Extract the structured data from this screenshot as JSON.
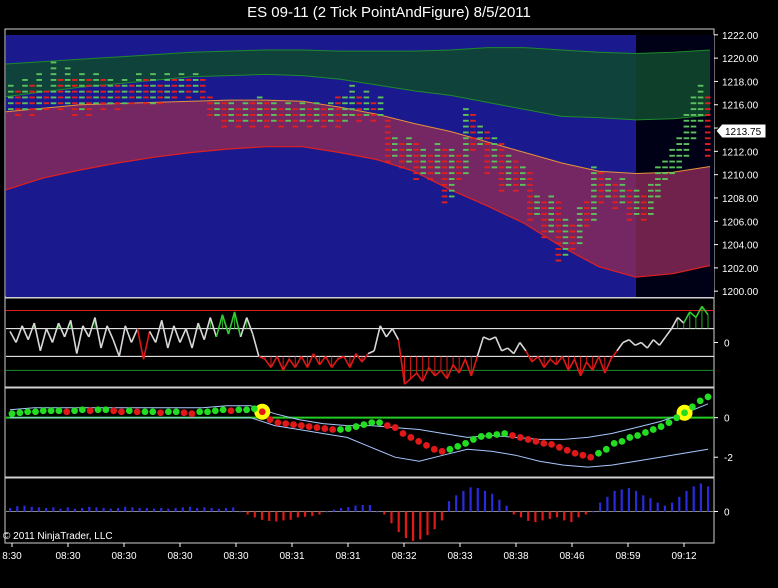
{
  "window": {
    "title": "ES 09-11 (2 Tick PointAndFigure)  8/5/2011"
  },
  "colors": {
    "background": "#000000",
    "up_box": "#5cc15c",
    "down_box": "#e01e1e",
    "band_blue": "#1c1c9c",
    "band_red": "#8c2a5a",
    "upper_band": "#17701c",
    "ma_line": "#e8913a",
    "dot_up": "#22dd22",
    "dot_down": "#e01818",
    "highlight": "#ffff00",
    "hist_pos": "#2a2ae0",
    "hist_neg": "#e01818"
  },
  "chart_data": [
    {
      "type": "point-and-figure",
      "panel": "price",
      "ylim": [
        1199.5,
        1222.5
      ],
      "y_ticks": [
        "1222.00",
        "1220.00",
        "1218.00",
        "1216.00",
        "1214.00",
        "1212.00",
        "1210.00",
        "1208.00",
        "1206.00",
        "1204.00",
        "1202.00",
        "1200.00"
      ],
      "last_price_label": "1213.75",
      "last_price": 1213.75,
      "columns": [
        {
          "low": 1215.5,
          "high": 1217.5,
          "dir": "up"
        },
        {
          "low": 1215.0,
          "high": 1217.0,
          "dir": "down"
        },
        {
          "low": 1215.5,
          "high": 1218.0,
          "dir": "up"
        },
        {
          "low": 1215.0,
          "high": 1217.5,
          "dir": "down"
        },
        {
          "low": 1215.5,
          "high": 1218.5,
          "dir": "up"
        },
        {
          "low": 1215.5,
          "high": 1217.0,
          "dir": "down"
        },
        {
          "low": 1216.0,
          "high": 1219.5,
          "dir": "up"
        },
        {
          "low": 1215.5,
          "high": 1218.0,
          "dir": "down"
        },
        {
          "low": 1216.0,
          "high": 1219.0,
          "dir": "up"
        },
        {
          "low": 1215.0,
          "high": 1218.0,
          "dir": "down"
        },
        {
          "low": 1215.5,
          "high": 1218.5,
          "dir": "up"
        },
        {
          "low": 1215.0,
          "high": 1218.0,
          "dir": "down"
        },
        {
          "low": 1216.0,
          "high": 1218.5,
          "dir": "up"
        },
        {
          "low": 1215.5,
          "high": 1218.0,
          "dir": "down"
        },
        {
          "low": 1216.0,
          "high": 1218.0,
          "dir": "up"
        },
        {
          "low": 1215.5,
          "high": 1217.5,
          "dir": "down"
        },
        {
          "low": 1216.0,
          "high": 1218.0,
          "dir": "up"
        },
        {
          "low": 1216.0,
          "high": 1217.5,
          "dir": "down"
        },
        {
          "low": 1216.5,
          "high": 1218.5,
          "dir": "up"
        },
        {
          "low": 1216.0,
          "high": 1218.0,
          "dir": "down"
        },
        {
          "low": 1216.0,
          "high": 1218.5,
          "dir": "up"
        },
        {
          "low": 1216.0,
          "high": 1217.5,
          "dir": "down"
        },
        {
          "low": 1216.5,
          "high": 1218.5,
          "dir": "up"
        },
        {
          "low": 1216.5,
          "high": 1218.0,
          "dir": "down"
        },
        {
          "low": 1217.0,
          "high": 1218.5,
          "dir": "up"
        },
        {
          "low": 1216.5,
          "high": 1218.0,
          "dir": "down"
        },
        {
          "low": 1217.0,
          "high": 1218.5,
          "dir": "up"
        },
        {
          "low": 1216.5,
          "high": 1218.0,
          "dir": "down"
        },
        {
          "low": 1215.0,
          "high": 1216.5,
          "dir": "down"
        },
        {
          "low": 1215.0,
          "high": 1216.0,
          "dir": "up"
        },
        {
          "low": 1214.0,
          "high": 1216.0,
          "dir": "down"
        },
        {
          "low": 1214.5,
          "high": 1216.0,
          "dir": "up"
        },
        {
          "low": 1214.0,
          "high": 1215.5,
          "dir": "down"
        },
        {
          "low": 1214.5,
          "high": 1216.0,
          "dir": "up"
        },
        {
          "low": 1214.0,
          "high": 1216.0,
          "dir": "down"
        },
        {
          "low": 1214.5,
          "high": 1216.5,
          "dir": "up"
        },
        {
          "low": 1214.0,
          "high": 1216.0,
          "dir": "down"
        },
        {
          "low": 1214.5,
          "high": 1216.0,
          "dir": "up"
        },
        {
          "low": 1214.0,
          "high": 1215.5,
          "dir": "down"
        },
        {
          "low": 1214.5,
          "high": 1216.0,
          "dir": "up"
        },
        {
          "low": 1214.0,
          "high": 1215.5,
          "dir": "down"
        },
        {
          "low": 1214.5,
          "high": 1216.0,
          "dir": "up"
        },
        {
          "low": 1214.0,
          "high": 1215.5,
          "dir": "down"
        },
        {
          "low": 1214.5,
          "high": 1216.0,
          "dir": "up"
        },
        {
          "low": 1214.0,
          "high": 1215.5,
          "dir": "down"
        },
        {
          "low": 1214.5,
          "high": 1216.0,
          "dir": "up"
        },
        {
          "low": 1214.0,
          "high": 1216.5,
          "dir": "down"
        },
        {
          "low": 1214.5,
          "high": 1216.5,
          "dir": "up"
        },
        {
          "low": 1215.0,
          "high": 1217.5,
          "dir": "up"
        },
        {
          "low": 1214.5,
          "high": 1216.5,
          "dir": "down"
        },
        {
          "low": 1215.0,
          "high": 1217.0,
          "dir": "up"
        },
        {
          "low": 1214.5,
          "high": 1216.0,
          "dir": "down"
        },
        {
          "low": 1215.0,
          "high": 1216.5,
          "dir": "up"
        },
        {
          "low": 1211.0,
          "high": 1214.5,
          "dir": "down"
        },
        {
          "low": 1211.5,
          "high": 1213.0,
          "dir": "up"
        },
        {
          "low": 1210.5,
          "high": 1212.5,
          "dir": "down"
        },
        {
          "low": 1211.0,
          "high": 1213.0,
          "dir": "up"
        },
        {
          "low": 1209.5,
          "high": 1212.5,
          "dir": "down"
        },
        {
          "low": 1210.0,
          "high": 1212.0,
          "dir": "up"
        },
        {
          "low": 1209.5,
          "high": 1211.5,
          "dir": "down"
        },
        {
          "low": 1210.0,
          "high": 1212.5,
          "dir": "up"
        },
        {
          "low": 1207.5,
          "high": 1212.0,
          "dir": "down"
        },
        {
          "low": 1208.0,
          "high": 1212.0,
          "dir": "up"
        },
        {
          "low": 1209.5,
          "high": 1211.5,
          "dir": "down"
        },
        {
          "low": 1210.0,
          "high": 1215.5,
          "dir": "up"
        },
        {
          "low": 1212.0,
          "high": 1215.0,
          "dir": "down"
        },
        {
          "low": 1212.5,
          "high": 1214.0,
          "dir": "up"
        },
        {
          "low": 1210.0,
          "high": 1213.5,
          "dir": "down"
        },
        {
          "low": 1210.5,
          "high": 1213.0,
          "dir": "up"
        },
        {
          "low": 1208.5,
          "high": 1212.5,
          "dir": "down"
        },
        {
          "low": 1209.0,
          "high": 1211.5,
          "dir": "up"
        },
        {
          "low": 1208.5,
          "high": 1211.0,
          "dir": "down"
        },
        {
          "low": 1209.0,
          "high": 1210.5,
          "dir": "up"
        },
        {
          "low": 1206.0,
          "high": 1210.0,
          "dir": "down"
        },
        {
          "low": 1206.5,
          "high": 1208.0,
          "dir": "up"
        },
        {
          "low": 1204.5,
          "high": 1207.5,
          "dir": "down"
        },
        {
          "low": 1205.0,
          "high": 1208.0,
          "dir": "up"
        },
        {
          "low": 1202.5,
          "high": 1207.5,
          "dir": "down"
        },
        {
          "low": 1203.0,
          "high": 1206.0,
          "dir": "up"
        },
        {
          "low": 1203.5,
          "high": 1205.5,
          "dir": "down"
        },
        {
          "low": 1204.0,
          "high": 1207.0,
          "dir": "up"
        },
        {
          "low": 1205.5,
          "high": 1207.5,
          "dir": "down"
        },
        {
          "low": 1206.0,
          "high": 1210.5,
          "dir": "up"
        },
        {
          "low": 1207.5,
          "high": 1210.0,
          "dir": "down"
        },
        {
          "low": 1208.0,
          "high": 1209.5,
          "dir": "up"
        },
        {
          "low": 1207.0,
          "high": 1209.0,
          "dir": "down"
        },
        {
          "low": 1207.5,
          "high": 1209.5,
          "dir": "up"
        },
        {
          "low": 1206.0,
          "high": 1208.5,
          "dir": "down"
        },
        {
          "low": 1206.5,
          "high": 1208.5,
          "dir": "up"
        },
        {
          "low": 1206.0,
          "high": 1208.0,
          "dir": "down"
        },
        {
          "low": 1206.5,
          "high": 1209.0,
          "dir": "up"
        },
        {
          "low": 1208.0,
          "high": 1210.5,
          "dir": "up"
        },
        {
          "low": 1209.5,
          "high": 1211.0,
          "dir": "up"
        },
        {
          "low": 1210.0,
          "high": 1212.0,
          "dir": "up"
        },
        {
          "low": 1210.5,
          "high": 1213.0,
          "dir": "up"
        },
        {
          "low": 1211.5,
          "high": 1215.0,
          "dir": "up"
        },
        {
          "low": 1213.0,
          "high": 1216.5,
          "dir": "up"
        },
        {
          "low": 1214.5,
          "high": 1217.5,
          "dir": "up"
        },
        {
          "low": 1211.5,
          "high": 1216.5,
          "dir": "down"
        }
      ],
      "upper_band": [
        1219.5,
        1219.7,
        1219.9,
        1220.1,
        1220.3,
        1220.5,
        1220.6,
        1220.7,
        1220.7,
        1220.6,
        1220.6,
        1220.6,
        1220.7,
        1220.9,
        1220.9,
        1220.7,
        1220.5,
        1220.4,
        1220.5,
        1220.7
      ],
      "mid_line": [
        1216.7,
        1217.1,
        1217.5,
        1217.8,
        1218.1,
        1218.4,
        1218.5,
        1218.6,
        1218.5,
        1218.2,
        1217.7,
        1217.2,
        1216.8,
        1216.2,
        1215.6,
        1215.0,
        1214.9,
        1214.7,
        1214.8,
        1215.1
      ],
      "ma_line": [
        1215.4,
        1215.7,
        1216.0,
        1216.1,
        1216.2,
        1216.3,
        1216.4,
        1216.4,
        1216.3,
        1215.8,
        1215.2,
        1214.4,
        1213.7,
        1212.8,
        1211.9,
        1211.0,
        1210.3,
        1210.1,
        1210.2,
        1210.7
      ],
      "lower_band": [
        1208.7,
        1209.7,
        1210.4,
        1211.0,
        1211.5,
        1211.9,
        1212.2,
        1212.4,
        1212.4,
        1211.9,
        1211.3,
        1210.3,
        1208.7,
        1207.3,
        1205.8,
        1203.8,
        1202.1,
        1201.2,
        1201.5,
        1202.2
      ]
    },
    {
      "type": "line",
      "panel": "oscillator-1",
      "ylim": [
        -1.6,
        1.6
      ],
      "y_ticks": [
        "0"
      ],
      "levels": [
        1.15,
        0.5,
        -0.5,
        -1.0
      ],
      "values": [
        0.4,
        0.0,
        0.6,
        0.1,
        0.7,
        -0.3,
        0.5,
        0.0,
        0.7,
        0.2,
        0.8,
        -0.4,
        0.6,
        0.2,
        0.9,
        -0.2,
        0.6,
        0.1,
        -0.5,
        0.6,
        0.0,
        0.5,
        -0.6,
        0.4,
        0.0,
        0.8,
        -0.2,
        0.6,
        0.0,
        0.5,
        -0.2,
        0.7,
        0.1,
        0.9,
        0.2,
        1.0,
        0.3,
        1.1,
        0.2,
        0.9,
        0.3,
        -0.5,
        -0.6,
        -0.9,
        -0.5,
        -1.0,
        -0.6,
        -0.9,
        -0.5,
        -0.9,
        -0.4,
        -0.8,
        -0.5,
        -0.9,
        -0.6,
        -0.5,
        -0.9,
        -0.4,
        -0.7,
        -0.4,
        -0.3,
        0.6,
        0.2,
        0.5,
        0.1,
        -1.5,
        -1.3,
        -1.1,
        -1.4,
        -0.9,
        -1.2,
        -1.0,
        -1.3,
        -0.8,
        -1.1,
        -0.6,
        -1.2,
        -0.5,
        0.2,
        0.1,
        0.2,
        -0.3,
        -0.2,
        -0.4,
        0.0,
        -0.3,
        -0.7,
        -0.5,
        -0.9,
        -0.6,
        -0.8,
        -0.5,
        -1.0,
        -0.6,
        -1.2,
        -0.7,
        -1.0,
        -0.5,
        -1.1,
        -0.6,
        -0.3,
        0.0,
        0.1,
        -0.1,
        0.0,
        -0.2,
        0.1,
        -0.1,
        0.2,
        0.5,
        0.9,
        0.7,
        1.1,
        0.9,
        1.3,
        1.0
      ]
    },
    {
      "type": "scatter",
      "panel": "oscillator-2",
      "ylim": [
        -3.0,
        1.5
      ],
      "y_ticks": [
        "0",
        "-2"
      ],
      "values": [
        0.2,
        0.25,
        0.3,
        0.3,
        0.35,
        0.35,
        0.35,
        0.3,
        0.35,
        0.4,
        0.35,
        0.4,
        0.4,
        0.35,
        0.3,
        0.35,
        0.3,
        0.3,
        0.3,
        0.25,
        0.3,
        0.3,
        0.25,
        0.2,
        0.3,
        0.3,
        0.35,
        0.4,
        0.35,
        0.4,
        0.4,
        0.45,
        0.3,
        -0.1,
        -0.25,
        -0.3,
        -0.35,
        -0.4,
        -0.45,
        -0.5,
        -0.55,
        -0.6,
        -0.6,
        -0.55,
        -0.45,
        -0.35,
        -0.25,
        -0.25,
        -0.4,
        -0.5,
        -0.8,
        -1.0,
        -1.2,
        -1.4,
        -1.6,
        -1.7,
        -1.6,
        -1.45,
        -1.3,
        -1.1,
        -0.95,
        -0.9,
        -0.85,
        -0.8,
        -0.9,
        -1.0,
        -1.1,
        -1.2,
        -1.3,
        -1.35,
        -1.5,
        -1.65,
        -1.8,
        -1.9,
        -2.0,
        -1.8,
        -1.6,
        -1.3,
        -1.2,
        -1.0,
        -0.9,
        -0.75,
        -0.6,
        -0.45,
        -0.25,
        0.0,
        0.25,
        0.55,
        0.85,
        1.05
      ],
      "upper_band": [
        0.4,
        0.5,
        0.5,
        0.5,
        0.5,
        0.5,
        0.5,
        0.5,
        0.5,
        0.6,
        0.6,
        0.2,
        -0.1,
        -0.3,
        -0.4,
        -0.4,
        -0.5,
        -0.6,
        -0.8,
        -1.0,
        -0.9,
        -1.0,
        -1.1,
        -1.1,
        -1.0,
        -0.8,
        -0.5,
        -0.2,
        0.2,
        0.7
      ],
      "lower_band": [
        0.0,
        0.0,
        0.0,
        0.0,
        0.0,
        0.0,
        0.0,
        0.0,
        0.0,
        0.0,
        0.0,
        -0.4,
        -0.6,
        -0.8,
        -1.0,
        -1.5,
        -2.0,
        -2.2,
        -1.9,
        -1.6,
        -1.7,
        -1.9,
        -2.2,
        -2.4,
        -2.5,
        -2.4,
        -2.2,
        -2.0,
        -1.8,
        -1.6
      ],
      "highlights": [
        32,
        86
      ]
    },
    {
      "type": "bar",
      "panel": "histogram",
      "ylim": [
        -1.0,
        1.0
      ],
      "y_ticks": [
        "0"
      ],
      "values": [
        0.12,
        0.18,
        0.2,
        0.16,
        0.14,
        0.12,
        0.14,
        0.1,
        0.14,
        0.1,
        0.12,
        0.16,
        0.14,
        0.12,
        0.1,
        0.12,
        0.16,
        0.14,
        0.12,
        0.12,
        0.1,
        0.12,
        0.1,
        0.12,
        0.14,
        0.16,
        0.12,
        0.14,
        0.12,
        0.1,
        0.12,
        0.14,
        0.0,
        -0.1,
        -0.2,
        -0.28,
        -0.32,
        -0.34,
        -0.3,
        -0.28,
        -0.2,
        -0.18,
        -0.15,
        -0.1,
        0.0,
        0.06,
        0.12,
        0.15,
        0.2,
        0.22,
        0.22,
        0.0,
        -0.1,
        -0.4,
        -0.7,
        -0.9,
        -1.0,
        -0.95,
        -0.8,
        -0.6,
        -0.3,
        0.35,
        0.55,
        0.7,
        0.82,
        0.8,
        0.7,
        0.6,
        0.4,
        0.2,
        -0.1,
        -0.2,
        -0.32,
        -0.36,
        -0.3,
        -0.25,
        -0.2,
        -0.3,
        -0.36,
        -0.2,
        -0.1,
        0.0,
        0.3,
        0.5,
        0.7,
        0.75,
        0.8,
        0.7,
        0.55,
        0.45,
        0.3,
        0.2,
        0.3,
        0.5,
        0.7,
        0.85,
        0.95,
        0.85
      ],
      "x_ticks": [
        "8:30",
        "08:30",
        "08:30",
        "08:30",
        "08:30",
        "08:31",
        "08:31",
        "08:32",
        "08:33",
        "08:38",
        "08:46",
        "08:59",
        "09:12"
      ]
    }
  ],
  "footer": {
    "copyright": "© 2011 NinjaTrader, LLC"
  }
}
